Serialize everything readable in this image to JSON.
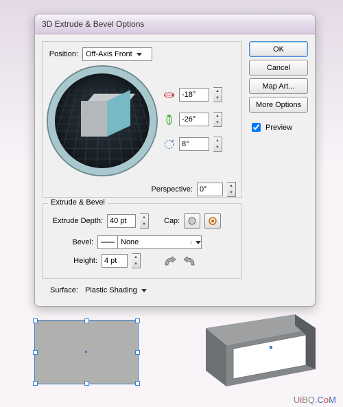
{
  "dialog": {
    "title": "3D Extrude & Bevel Options",
    "position_label": "Position:",
    "position_value": "Off-Axis Front",
    "angles": {
      "x": "-18°",
      "y": "-26°",
      "z": "8°"
    },
    "perspective_label": "Perspective:",
    "perspective_value": "0°",
    "extrude_section_label": "Extrude & Bevel",
    "extrude_depth_label": "Extrude Depth:",
    "extrude_depth_value": "40 pt",
    "cap_label": "Cap:",
    "bevel_label": "Bevel:",
    "bevel_value": "None",
    "height_label": "Height:",
    "height_value": "4 pt",
    "surface_label": "Surface:",
    "surface_value": "Plastic Shading"
  },
  "buttons": {
    "ok": "OK",
    "cancel": "Cancel",
    "map_art": "Map Art...",
    "more_options": "More Options",
    "preview_label": "Preview"
  },
  "watermark": {
    "pre": "U",
    "i": "i",
    "mid": "BQ.",
    "c": "C",
    "o": "o",
    "m": "M"
  }
}
